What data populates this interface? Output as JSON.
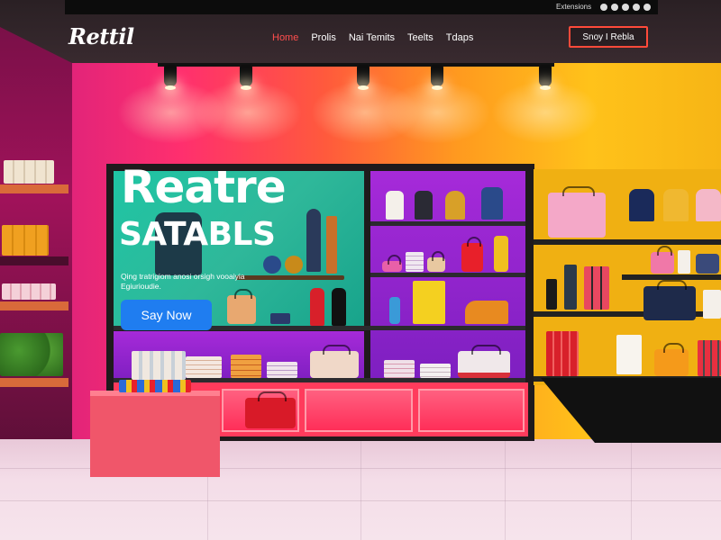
{
  "topbar": {
    "text": "Extensions",
    "social_icons": [
      "globe-icon",
      "facebook-icon",
      "twitter-icon",
      "instagram-icon",
      "pinterest-icon"
    ]
  },
  "brand": {
    "logo": "Rettil"
  },
  "nav": {
    "items": [
      {
        "label": "Home",
        "active": true
      },
      {
        "label": "Prolis",
        "active": false
      },
      {
        "label": "Nai Temits",
        "active": false
      },
      {
        "label": "Teelts",
        "active": false
      },
      {
        "label": "Tdaps",
        "active": false
      }
    ],
    "cta_label": "Snoy I Rebla"
  },
  "hero": {
    "title": "Reatre",
    "subtitle": "SATABLS",
    "description": "Qing tratrigiom anosi orsigh vooaiyia Egiurioudie.",
    "button_label": "Say Now"
  },
  "colors": {
    "accent": "#ff4a3a",
    "nav_active": "#ff4e4e",
    "button": "#1f7df0",
    "hero_panel": "#1fc5a4",
    "wall_pink": "#ff2f6e",
    "wall_yellow": "#ffc21a",
    "bay_purple": "#a62ad9"
  }
}
